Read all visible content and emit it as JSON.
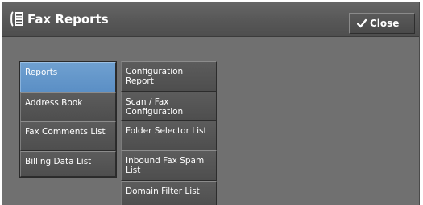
{
  "header": {
    "title": "Fax Reports",
    "title_icon": "fax-report-icon",
    "close_label": "Close",
    "close_icon": "checkmark-icon"
  },
  "left_menu": {
    "items": [
      {
        "label": "Reports",
        "selected": true
      },
      {
        "label": "Address Book",
        "selected": false
      },
      {
        "label": "Fax Comments List",
        "selected": false
      },
      {
        "label": "Billing Data List",
        "selected": false
      }
    ]
  },
  "right_menu": {
    "items": [
      {
        "label": "Configuration Report"
      },
      {
        "label": "Scan / Fax Configuration"
      },
      {
        "label": "Folder Selector List"
      },
      {
        "label": "Inbound Fax Spam List"
      },
      {
        "label": "Domain Filter List"
      }
    ]
  },
  "colors": {
    "background": "#707070",
    "titlebar": "#575757",
    "selected_button": "#5b8fc5",
    "button": "#555555"
  }
}
